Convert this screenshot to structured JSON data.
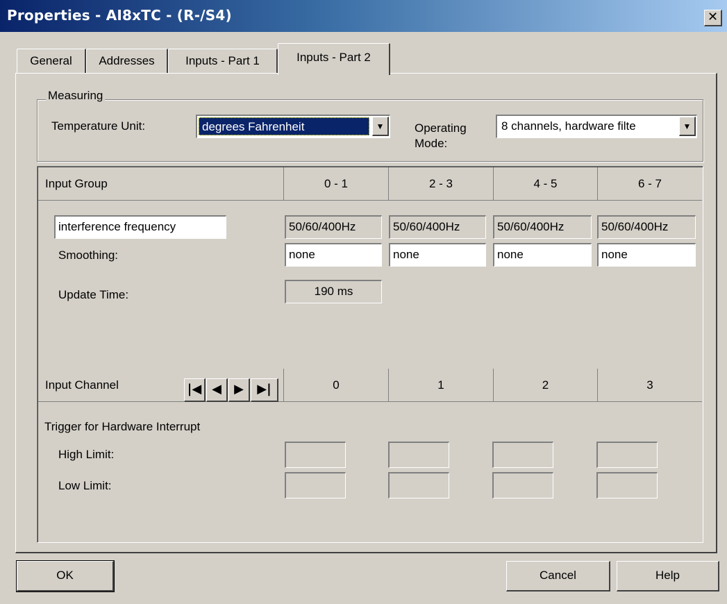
{
  "window": {
    "title": "Properties - AI8xTC - (R-/S4)",
    "close_glyph": "✕"
  },
  "tabs": [
    {
      "label": "General"
    },
    {
      "label": "Addresses"
    },
    {
      "label": "Inputs - Part 1"
    },
    {
      "label": "Inputs - Part 2",
      "active": true
    }
  ],
  "measuring": {
    "legend": "Measuring",
    "temperature_unit_label": "Temperature Unit:",
    "temperature_unit_value": "degrees Fahrenheit",
    "operating_mode_label_line1": "Operating",
    "operating_mode_label_line2": "Mode:",
    "operating_mode_value": "8 channels, hardware filte"
  },
  "input_group": {
    "header": "Input Group",
    "columns": [
      "0 - 1",
      "2 - 3",
      "4 - 5",
      "6 - 7"
    ],
    "interference_label": "interference frequency",
    "interference_values": [
      "50/60/400Hz",
      "50/60/400Hz",
      "50/60/400Hz",
      "50/60/400Hz"
    ],
    "smoothing_label": "Smoothing:",
    "smoothing_values": [
      "none",
      "none",
      "none",
      "none"
    ],
    "update_time_label": "Update Time:",
    "update_time_value": "190 ms"
  },
  "input_channel": {
    "header": "Input Channel",
    "nav": {
      "first": "|◀",
      "prev": "◀",
      "next": "▶",
      "last": "▶|"
    },
    "columns": [
      "0",
      "1",
      "2",
      "3"
    ],
    "trigger_label": "Trigger for Hardware Interrupt",
    "high_limit_label": "High Limit:",
    "low_limit_label": "Low Limit:",
    "high_limit_values": [
      "",
      "",
      "",
      ""
    ],
    "low_limit_values": [
      "",
      "",
      "",
      ""
    ]
  },
  "buttons": {
    "ok": "OK",
    "cancel": "Cancel",
    "help": "Help"
  },
  "colors": {
    "face": "#d4d0c8",
    "title_start": "#0a246a",
    "title_end": "#a6caf0",
    "selection": "#0a246a"
  }
}
